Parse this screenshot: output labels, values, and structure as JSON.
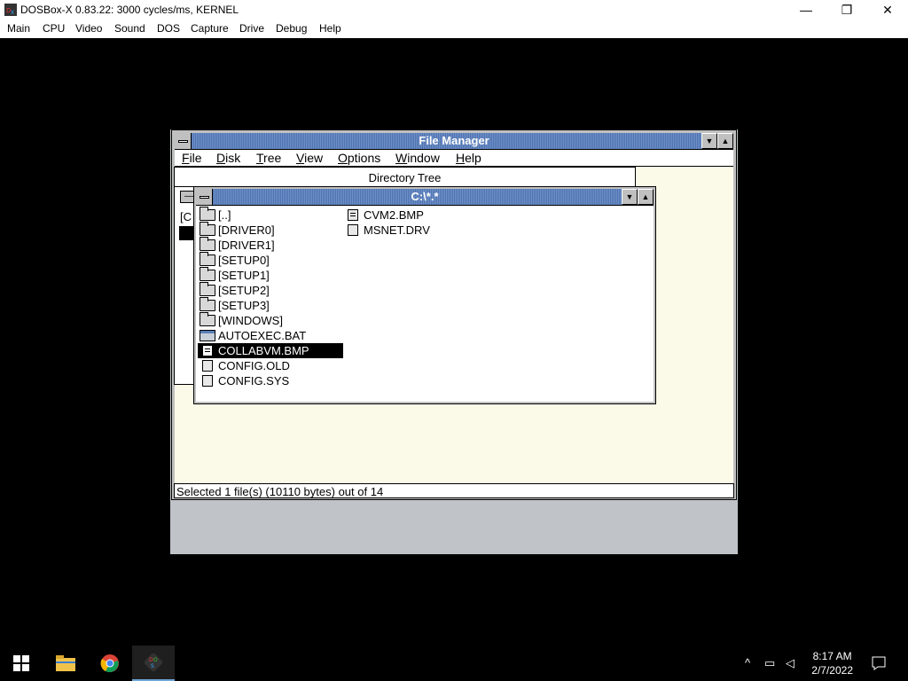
{
  "host": {
    "title": "DOSBox-X 0.83.22: 3000 cycles/ms, KERNEL",
    "menu": [
      "Main",
      "CPU",
      "Video",
      "Sound",
      "DOS",
      "Capture",
      "Drive",
      "Debug",
      "Help"
    ],
    "minimize_glyph": "—",
    "maximize_glyph": "❐",
    "close_glyph": "✕"
  },
  "file_manager": {
    "title": "File Manager",
    "menu": [
      "File",
      "Disk",
      "Tree",
      "View",
      "Options",
      "Window",
      "Help"
    ],
    "menu_accel": [
      "F",
      "D",
      "T",
      "V",
      "O",
      "W",
      "H"
    ],
    "status": "Selected 1 file(s) (10110 bytes) out of 14"
  },
  "tree_window": {
    "title": "Directory Tree",
    "drive_label": "—",
    "root_label": "[C"
  },
  "dir_window": {
    "title": "C:\\*.*",
    "col1": [
      {
        "name": "[..]",
        "icon": "folder-icon"
      },
      {
        "name": "[DRIVER0]",
        "icon": "folder-icon"
      },
      {
        "name": "[DRIVER1]",
        "icon": "folder-icon"
      },
      {
        "name": "[SETUP0]",
        "icon": "folder-icon"
      },
      {
        "name": "[SETUP1]",
        "icon": "folder-icon"
      },
      {
        "name": "[SETUP2]",
        "icon": "folder-icon"
      },
      {
        "name": "[SETUP3]",
        "icon": "folder-icon"
      },
      {
        "name": "[WINDOWS]",
        "icon": "folder-icon"
      },
      {
        "name": "AUTOEXEC.BAT",
        "icon": "program-icon"
      },
      {
        "name": "COLLABVM.BMP",
        "icon": "document-icon",
        "selected": true
      },
      {
        "name": "CONFIG.OLD",
        "icon": "file-icon"
      },
      {
        "name": "CONFIG.SYS",
        "icon": "file-icon"
      }
    ],
    "col2": [
      {
        "name": "CVM2.BMP",
        "icon": "document-icon"
      },
      {
        "name": "MSNET.DRV",
        "icon": "file-icon"
      }
    ]
  },
  "taskbar": {
    "time": "8:17 AM",
    "date": "2/7/2022"
  },
  "colors": {
    "title_active": "#5a7fb8",
    "desktop": "#c0c4c8",
    "workspace": "#fbf9e8"
  }
}
